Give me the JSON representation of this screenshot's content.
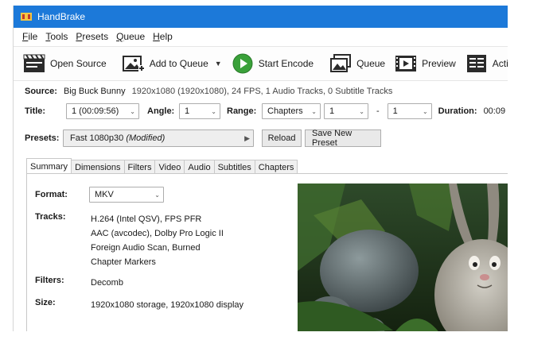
{
  "window": {
    "title": "HandBrake"
  },
  "menu": {
    "items": [
      {
        "underline": "F",
        "rest": "ile"
      },
      {
        "underline": "T",
        "rest": "ools"
      },
      {
        "underline": "P",
        "rest": "resets"
      },
      {
        "underline": "Q",
        "rest": "ueue"
      },
      {
        "underline": "H",
        "rest": "elp"
      }
    ]
  },
  "toolbar": {
    "open_source": "Open Source",
    "add_to_queue": "Add to Queue",
    "start_encode": "Start Encode",
    "queue": "Queue",
    "preview": "Preview",
    "activity": "Activity"
  },
  "source": {
    "label": "Source:",
    "name": "Big Buck Bunny",
    "info": "1920x1080 (1920x1080), 24 FPS, 1 Audio Tracks, 0 Subtitle Tracks"
  },
  "title_row": {
    "title_label": "Title:",
    "title_value": "1 (00:09:56)",
    "angle_label": "Angle:",
    "angle_value": "1",
    "range_label": "Range:",
    "range_value": "Chapters",
    "range_start": "1",
    "dash": "-",
    "range_end": "1",
    "duration_label": "Duration:",
    "duration_value": "00:09"
  },
  "presets": {
    "label": "Presets:",
    "value": "Fast 1080p30",
    "modified": "(Modified)",
    "reload": "Reload",
    "save_new": "Save New Preset"
  },
  "tabs": [
    "Summary",
    "Dimensions",
    "Filters",
    "Video",
    "Audio",
    "Subtitles",
    "Chapters"
  ],
  "summary": {
    "format_label": "Format:",
    "format_value": "MKV",
    "tracks_label": "Tracks:",
    "tracks": [
      "H.264 (Intel QSV),  FPS PFR",
      "AAC (avcodec), Dolby Pro Logic II",
      "Foreign Audio Scan, Burned",
      "Chapter Markers"
    ],
    "filters_label": "Filters:",
    "filters_value": "Decomb",
    "size_label": "Size:",
    "size_value": "1920x1080 storage, 1920x1080 display"
  },
  "colors": {
    "titlebar": "#1c79d9",
    "play_green": "#3aa13a"
  }
}
